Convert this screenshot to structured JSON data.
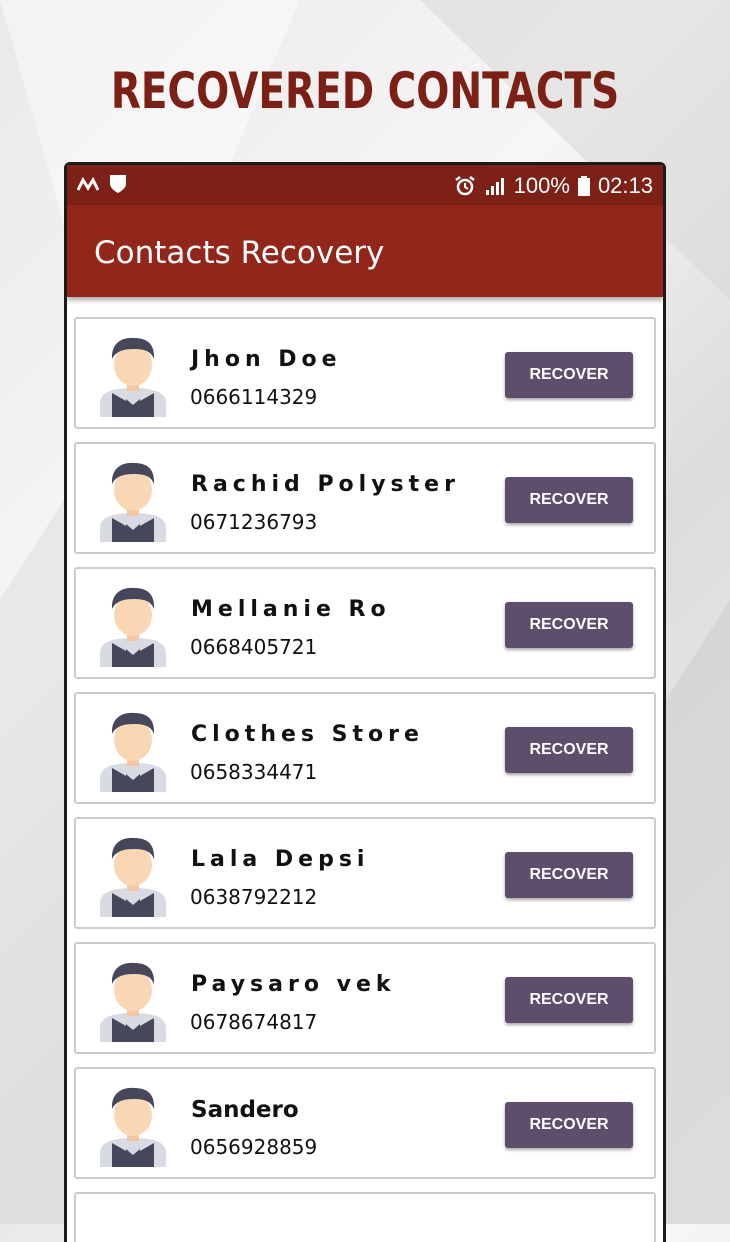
{
  "promo_title": "RECOVERED CONTACTS",
  "status_bar": {
    "battery": "100%",
    "time": "02:13"
  },
  "app_title": "Contacts Recovery",
  "recover_label": "RECOVER",
  "contacts": [
    {
      "name": "Jhon Doe",
      "phone": "0666114329"
    },
    {
      "name": "Rachid Polyster",
      "phone": "0671236793"
    },
    {
      "name": "Mellanie Ro",
      "phone": "0668405721"
    },
    {
      "name": "Clothes Store",
      "phone": "0658334471"
    },
    {
      "name": "Lala Depsi",
      "phone": "0638792212"
    },
    {
      "name": "Paysaro vek",
      "phone": "0678674817"
    },
    {
      "name": "Sandero",
      "phone": "0656928859"
    }
  ],
  "colors": {
    "title": "#7c1f14",
    "status_bar": "#7d2117",
    "app_bar": "#93261b",
    "button": "#5d4e6c"
  }
}
